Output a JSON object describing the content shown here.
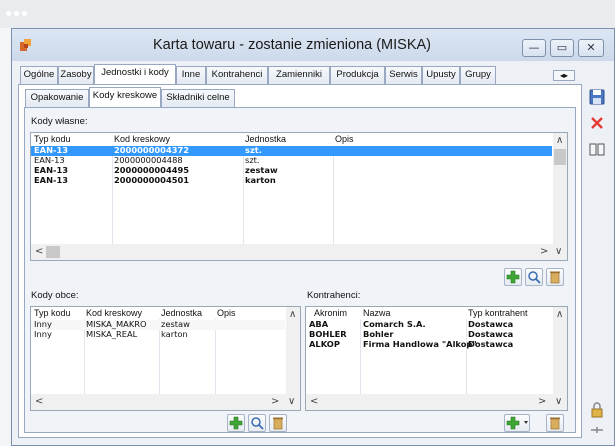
{
  "window": {
    "title": "Karta towaru - zostanie zmieniona (MISKA)",
    "minimize": "—",
    "maximize": "▭",
    "close": "✕"
  },
  "main_tabs": [
    "Ogólne",
    "Zasoby",
    "Jednostki i kody",
    "Inne",
    "Kontrahenci",
    "Zamienniki",
    "Produkcja",
    "Serwis",
    "Upusty",
    "Grupy"
  ],
  "tab_scroll": {
    "left": "◂",
    "right": "▸"
  },
  "sub_tabs": [
    "Opakowanie",
    "Kody kreskowe",
    "Składniki celne"
  ],
  "kody_wlasne": {
    "label": "Kody własne:",
    "headers": [
      "Typ kodu",
      "Kod kreskowy",
      "Jednostka",
      "Opis"
    ],
    "rows": [
      [
        "EAN-13",
        "2000000004372",
        "szt.",
        ""
      ],
      [
        "EAN-13",
        "2000000004488",
        "szt.",
        ""
      ],
      [
        "EAN-13",
        "2000000004495",
        "zestaw",
        ""
      ],
      [
        "EAN-13",
        "2000000004501",
        "karton",
        ""
      ]
    ]
  },
  "kody_obce": {
    "label": "Kody obce:",
    "headers": [
      "Typ kodu",
      "Kod kreskowy",
      "Jednostka",
      "Opis"
    ],
    "rows": [
      [
        "Inny",
        "MISKA_MAKRO",
        "zestaw",
        ""
      ],
      [
        "Inny",
        "MISKA_REAL",
        "karton",
        ""
      ]
    ]
  },
  "kontrahenci": {
    "label": "Kontrahenci:",
    "headers": [
      "Akronim",
      "Nazwa",
      "Typ kontrahent"
    ],
    "rows": [
      [
        "ABA",
        "Comarch S.A.",
        "Dostawca"
      ],
      [
        "BOHLER",
        "Bohler",
        "Dostawca"
      ],
      [
        "ALKOP",
        "Firma Handlowa \"Alkop\"",
        "Dostawca"
      ]
    ]
  },
  "scroll_glyphs": {
    "up": "∧",
    "down": "∨",
    "left": "<",
    "right": ">"
  },
  "colors": {
    "selection": "#3399ff",
    "add_icon": "#3fa535",
    "delete_icon": "#e53935",
    "trash_icon": "#c79a4a"
  }
}
